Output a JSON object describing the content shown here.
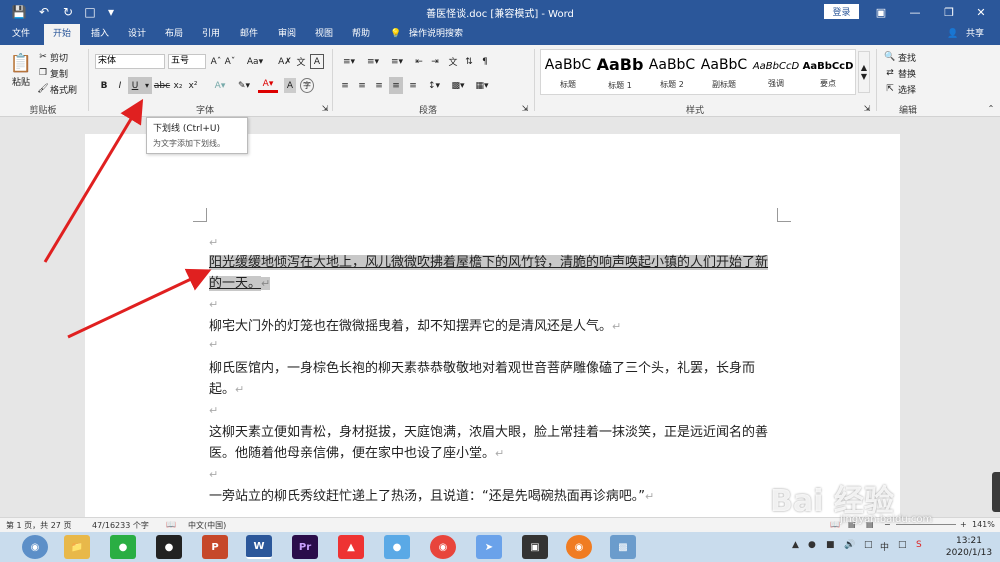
{
  "window": {
    "title": "善医怪谈.doc [兼容模式] - Word",
    "login": "登录"
  },
  "tabs": [
    "文件",
    "开始",
    "插入",
    "设计",
    "布局",
    "引用",
    "邮件",
    "审阅",
    "视图",
    "帮助"
  ],
  "tell_me": "操作说明搜索",
  "share": "共享",
  "clipboard": {
    "paste": "粘贴",
    "cut": "剪切",
    "copy": "复制",
    "format_painter": "格式刷",
    "label": "剪贴板"
  },
  "font": {
    "name": "宋体",
    "size": "五号",
    "label": "字体"
  },
  "paragraph": {
    "label": "段落"
  },
  "styles": {
    "label": "样式",
    "items": [
      {
        "sample": "AaBbC",
        "name": "标题"
      },
      {
        "sample": "AaBb",
        "name": "标题 1"
      },
      {
        "sample": "AaBbC",
        "name": "标题 2"
      },
      {
        "sample": "AaBbC",
        "name": "副标题"
      },
      {
        "sample": "AaBbCcD",
        "name": "强调"
      },
      {
        "sample": "AaBbCcD",
        "name": "要点"
      }
    ]
  },
  "editing": {
    "find": "查找",
    "replace": "替换",
    "select": "选择",
    "label": "编辑"
  },
  "tooltip": {
    "title": "下划线 (Ctrl+U)",
    "desc": "为文字添加下划线。"
  },
  "document": {
    "paragraphs": [
      "阳光缓缓地倾泻在大地上，风儿微微吹拂着屋檐下的风竹铃，清脆的响声唤起小镇的人们开始了新的一天。",
      "柳宅大门外的灯笼也在微微摇曳着，却不知摆弄它的是清风还是人气。",
      "柳氏医馆内，一身棕色长袍的柳天素恭恭敬敬地对着观世音菩萨雕像磕了三个头，礼罢，长身而起。",
      "这柳天素立便如青松，身材挺拔，天庭饱满，浓眉大眼，脸上常挂着一抹淡笑，正是远近闻名的善医。他随着他母亲信佛，便在家中也设了座小堂。",
      "一旁站立的柳氏秀纹赶忙递上了热汤，且说道：“还是先喝碗热面再诊病吧。”"
    ]
  },
  "status": {
    "page": "第 1 页，共 27 页",
    "words": "47/16233 个字",
    "lang": "中文(中国)",
    "zoom": "141%"
  },
  "taskbar": {
    "time": "13:21",
    "date": "2020/1/13"
  },
  "watermark": {
    "main": "Bai 经验",
    "url": "jingyan.baidu.com"
  }
}
